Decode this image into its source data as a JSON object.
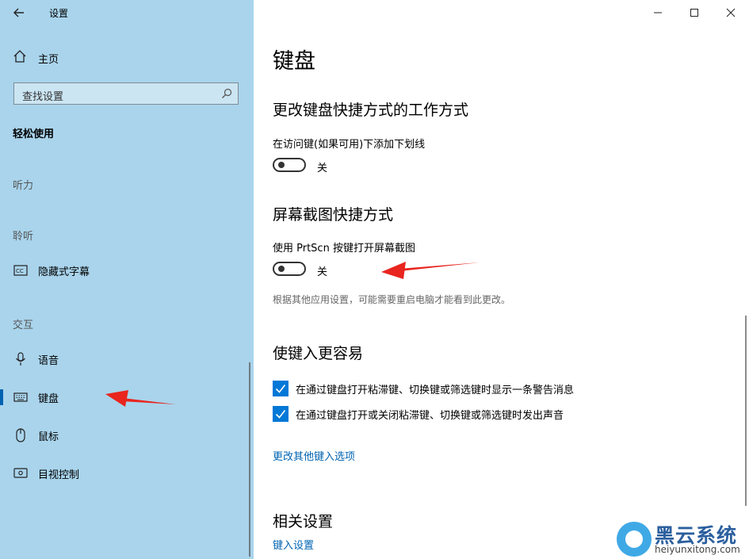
{
  "sidebar": {
    "app_title": "设置",
    "home_label": "主页",
    "search_placeholder": "查找设置",
    "section_title": "轻松使用",
    "groups": {
      "hearing": "听力",
      "listening": "聆听",
      "interaction": "交互"
    },
    "items": {
      "captions": "隐藏式字幕",
      "speech": "语音",
      "keyboard": "键盘",
      "mouse": "鼠标",
      "eye_control": "目视控制"
    }
  },
  "main": {
    "title": "键盘",
    "shortcuts": {
      "heading": "更改键盘快捷方式的工作方式",
      "underline_label": "在访问键(如果可用)下添加下划线",
      "underline_state": "关"
    },
    "screenshot": {
      "heading": "屏幕截图快捷方式",
      "prtscn_label": "使用 PrtScn 按键打开屏幕截图",
      "prtscn_state": "关",
      "note": "根据其他应用设置，可能需要重启电脑才能看到此更改。"
    },
    "typing": {
      "heading": "使键入更容易",
      "check1": "在通过键盘打开粘滞键、切换键或筛选键时显示一条警告消息",
      "check2": "在通过键盘打开或关闭粘滞键、切换键或筛选键时发出声音",
      "more_link": "更改其他键入选项"
    },
    "related": {
      "heading": "相关设置",
      "link": "键入设置"
    }
  },
  "watermark": {
    "title": "黑云系统",
    "url": "heiyunxitong.com"
  },
  "colors": {
    "sidebar_bg": "#a9d4ec",
    "accent": "#0078d7",
    "link": "#0063b1",
    "arrow": "#e8251e"
  }
}
